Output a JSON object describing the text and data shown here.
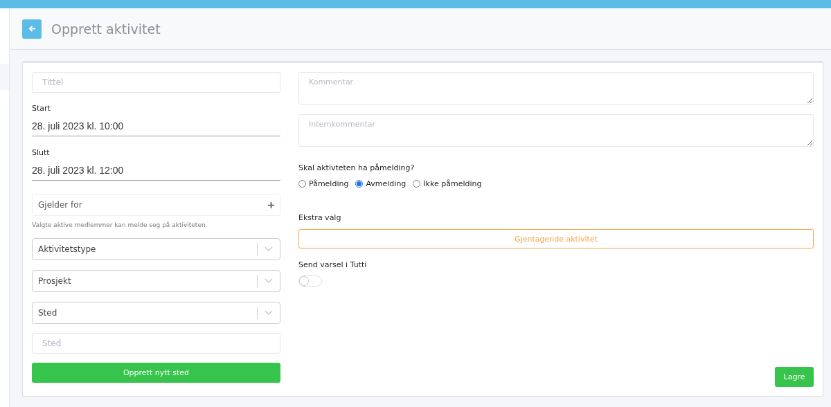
{
  "header": {
    "title": "Opprett aktivitet"
  },
  "form": {
    "title_field": {
      "placeholder": "Tittel"
    },
    "dates": [
      {
        "label": "Start",
        "value": "28. juli 2023 kl. 10:00"
      },
      {
        "label": "Slutt",
        "value": "28. juli 2023 kl. 12:00"
      }
    ],
    "applies_to": {
      "label": "Gjelder for",
      "hint": "Valgte aktive medlemmer kan melde seg på aktiviteten."
    },
    "selects": [
      {
        "placeholder": "Aktivitetstype"
      },
      {
        "placeholder": "Prosjekt"
      },
      {
        "placeholder": "Sted"
      }
    ],
    "place_field": {
      "placeholder": "Sted"
    },
    "create_place_button": "Opprett nytt sted",
    "comment_fields": [
      {
        "placeholder": "Kommentar"
      },
      {
        "placeholder": "Internkommentar"
      }
    ],
    "registration": {
      "question": "Skal aktivteten ha påmelding?",
      "options": [
        {
          "label": "Påmelding",
          "selected": false
        },
        {
          "label": "Avmelding",
          "selected": true
        },
        {
          "label": "Ikke påmelding",
          "selected": false
        }
      ]
    },
    "extra": {
      "label": "Ekstra valg",
      "button": "Gjentagende aktivitet"
    },
    "notify": {
      "label": "Send varsel i Tutti",
      "on": false
    },
    "save_button": "Lagre"
  }
}
